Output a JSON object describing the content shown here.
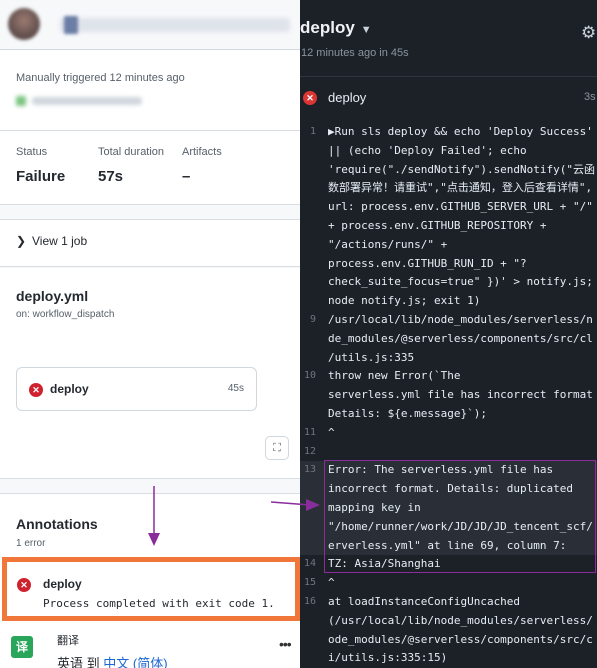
{
  "left_pane": {
    "trigger_text": "Manually triggered 12 minutes ago",
    "summary": {
      "status_label": "Status",
      "status_value": "Failure",
      "duration_label": "Total duration",
      "duration_value": "57s",
      "artifacts_label": "Artifacts",
      "artifacts_value": "–"
    },
    "view_job_label": "View 1 job",
    "workflow": {
      "title": "deploy.yml",
      "trigger": "on: workflow_dispatch"
    },
    "job": {
      "name": "deploy",
      "duration": "45s",
      "status_color": "#cf222e"
    },
    "annotations": {
      "title": "Annotations",
      "count": "1 error",
      "item": {
        "name": "deploy",
        "message": "Process completed with exit code 1."
      }
    },
    "translate_bar": {
      "title": "翻译",
      "from_lang": "英语",
      "to_word": "到",
      "to_lang": "中文 (简体)",
      "logo_text": "译"
    }
  },
  "right_pane": {
    "title": "deploy",
    "subtitle": "12 minutes ago in 45s",
    "job_name": "deploy",
    "job_time": "3s",
    "log_lines": [
      {
        "no": "1",
        "text": "▶Run sls deploy && echo 'Deploy Success'"
      },
      {
        "no": "",
        "text": "|| (echo 'Deploy Failed'; echo"
      },
      {
        "no": "",
        "text": "'require(\"./sendNotify\").sendNotify(\"云函"
      },
      {
        "no": "",
        "text": "数部署异常！请重试\",\"点击通知，登入后查看详情\","
      },
      {
        "no": "",
        "text": "url: process.env.GITHUB_SERVER_URL + \"/\""
      },
      {
        "no": "",
        "text": "+ process.env.GITHUB_REPOSITORY +"
      },
      {
        "no": "",
        "text": "\"/actions/runs/\" +"
      },
      {
        "no": "",
        "text": "process.env.GITHUB_RUN_ID + \"?"
      },
      {
        "no": "",
        "text": "check_suite_focus=true\" })' > notify.js;"
      },
      {
        "no": "",
        "text": "node notify.js; exit 1)"
      },
      {
        "no": "9",
        "text": "/usr/local/lib/node_modules/serverless/n"
      },
      {
        "no": "",
        "text": "de_modules/@serverless/components/src/cl"
      },
      {
        "no": "",
        "text": "/utils.js:335"
      },
      {
        "no": "10",
        "text": "      throw new Error(`The"
      },
      {
        "no": "",
        "text": "serverless.yml file has incorrect format"
      },
      {
        "no": "",
        "text": "Details: ${e.message}`);"
      },
      {
        "no": "11",
        "text": "        ^"
      },
      {
        "no": "12",
        "text": ""
      },
      {
        "no": "13",
        "text": "Error: The serverless.yml file has"
      },
      {
        "no": "",
        "text": "incorrect format. Details: duplicated"
      },
      {
        "no": "",
        "text": "mapping key in"
      },
      {
        "no": "",
        "text": "\"/home/runner/work/JD/JD/JD_tencent_scf/"
      },
      {
        "no": "",
        "text": "erverless.yml\" at line 69, column 7:"
      },
      {
        "no": "14",
        "text": "        TZ: Asia/Shanghai"
      },
      {
        "no": "15",
        "text": "        ^"
      },
      {
        "no": "16",
        "text": "    at loadInstanceConfigUncached"
      },
      {
        "no": "",
        "text": "(/usr/local/lib/node_modules/serverless/"
      },
      {
        "no": "",
        "text": "ode_modules/@serverless/components/src/c"
      },
      {
        "no": "",
        "text": "i/utils.js:335:15)"
      }
    ]
  },
  "colors": {
    "error_red": "#cf222e",
    "annotation_border": "#f0763a",
    "arrow_purple": "#8a2d9c",
    "dark_bg": "#1c2128"
  }
}
